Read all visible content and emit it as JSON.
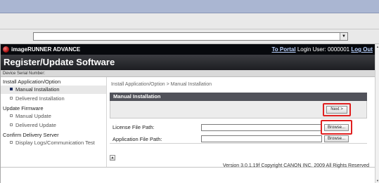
{
  "app": {
    "brand": "imageRUNNER ADVANCE",
    "nav": {
      "portal_link": "To Portal",
      "login_label": "Login User: 0000001",
      "logout_link": "Log Out"
    },
    "page_title": "Register/Update Software",
    "serial_label": "Device Serial Number:"
  },
  "sidebar": {
    "sections": [
      {
        "label": "Install Application/Option"
      },
      {
        "label": "Update Firmware"
      },
      {
        "label": "Confirm Delivery Server"
      }
    ],
    "items": [
      {
        "label": "Manual Installation",
        "active": true
      },
      {
        "label": "Delivered Installation"
      },
      {
        "label": "Manual Update"
      },
      {
        "label": "Delivered Update"
      },
      {
        "label": "Display Logs/Communication Test"
      }
    ]
  },
  "main": {
    "breadcrumb": "Install Application/Option > Manual Installation",
    "panel_title": "Manual Installation",
    "next_button": "Next >",
    "license_label": "License File Path:",
    "application_label": "Application File Path:",
    "browse_label": "Browse..."
  },
  "footer": {
    "version_text": "Version 3.0.1.19f Copyright CANON INC. 2009 All Rights Reserved"
  },
  "colors": {
    "highlight": "#e02020",
    "brand_bar": "#07090d",
    "panel_header": "#51525a"
  }
}
